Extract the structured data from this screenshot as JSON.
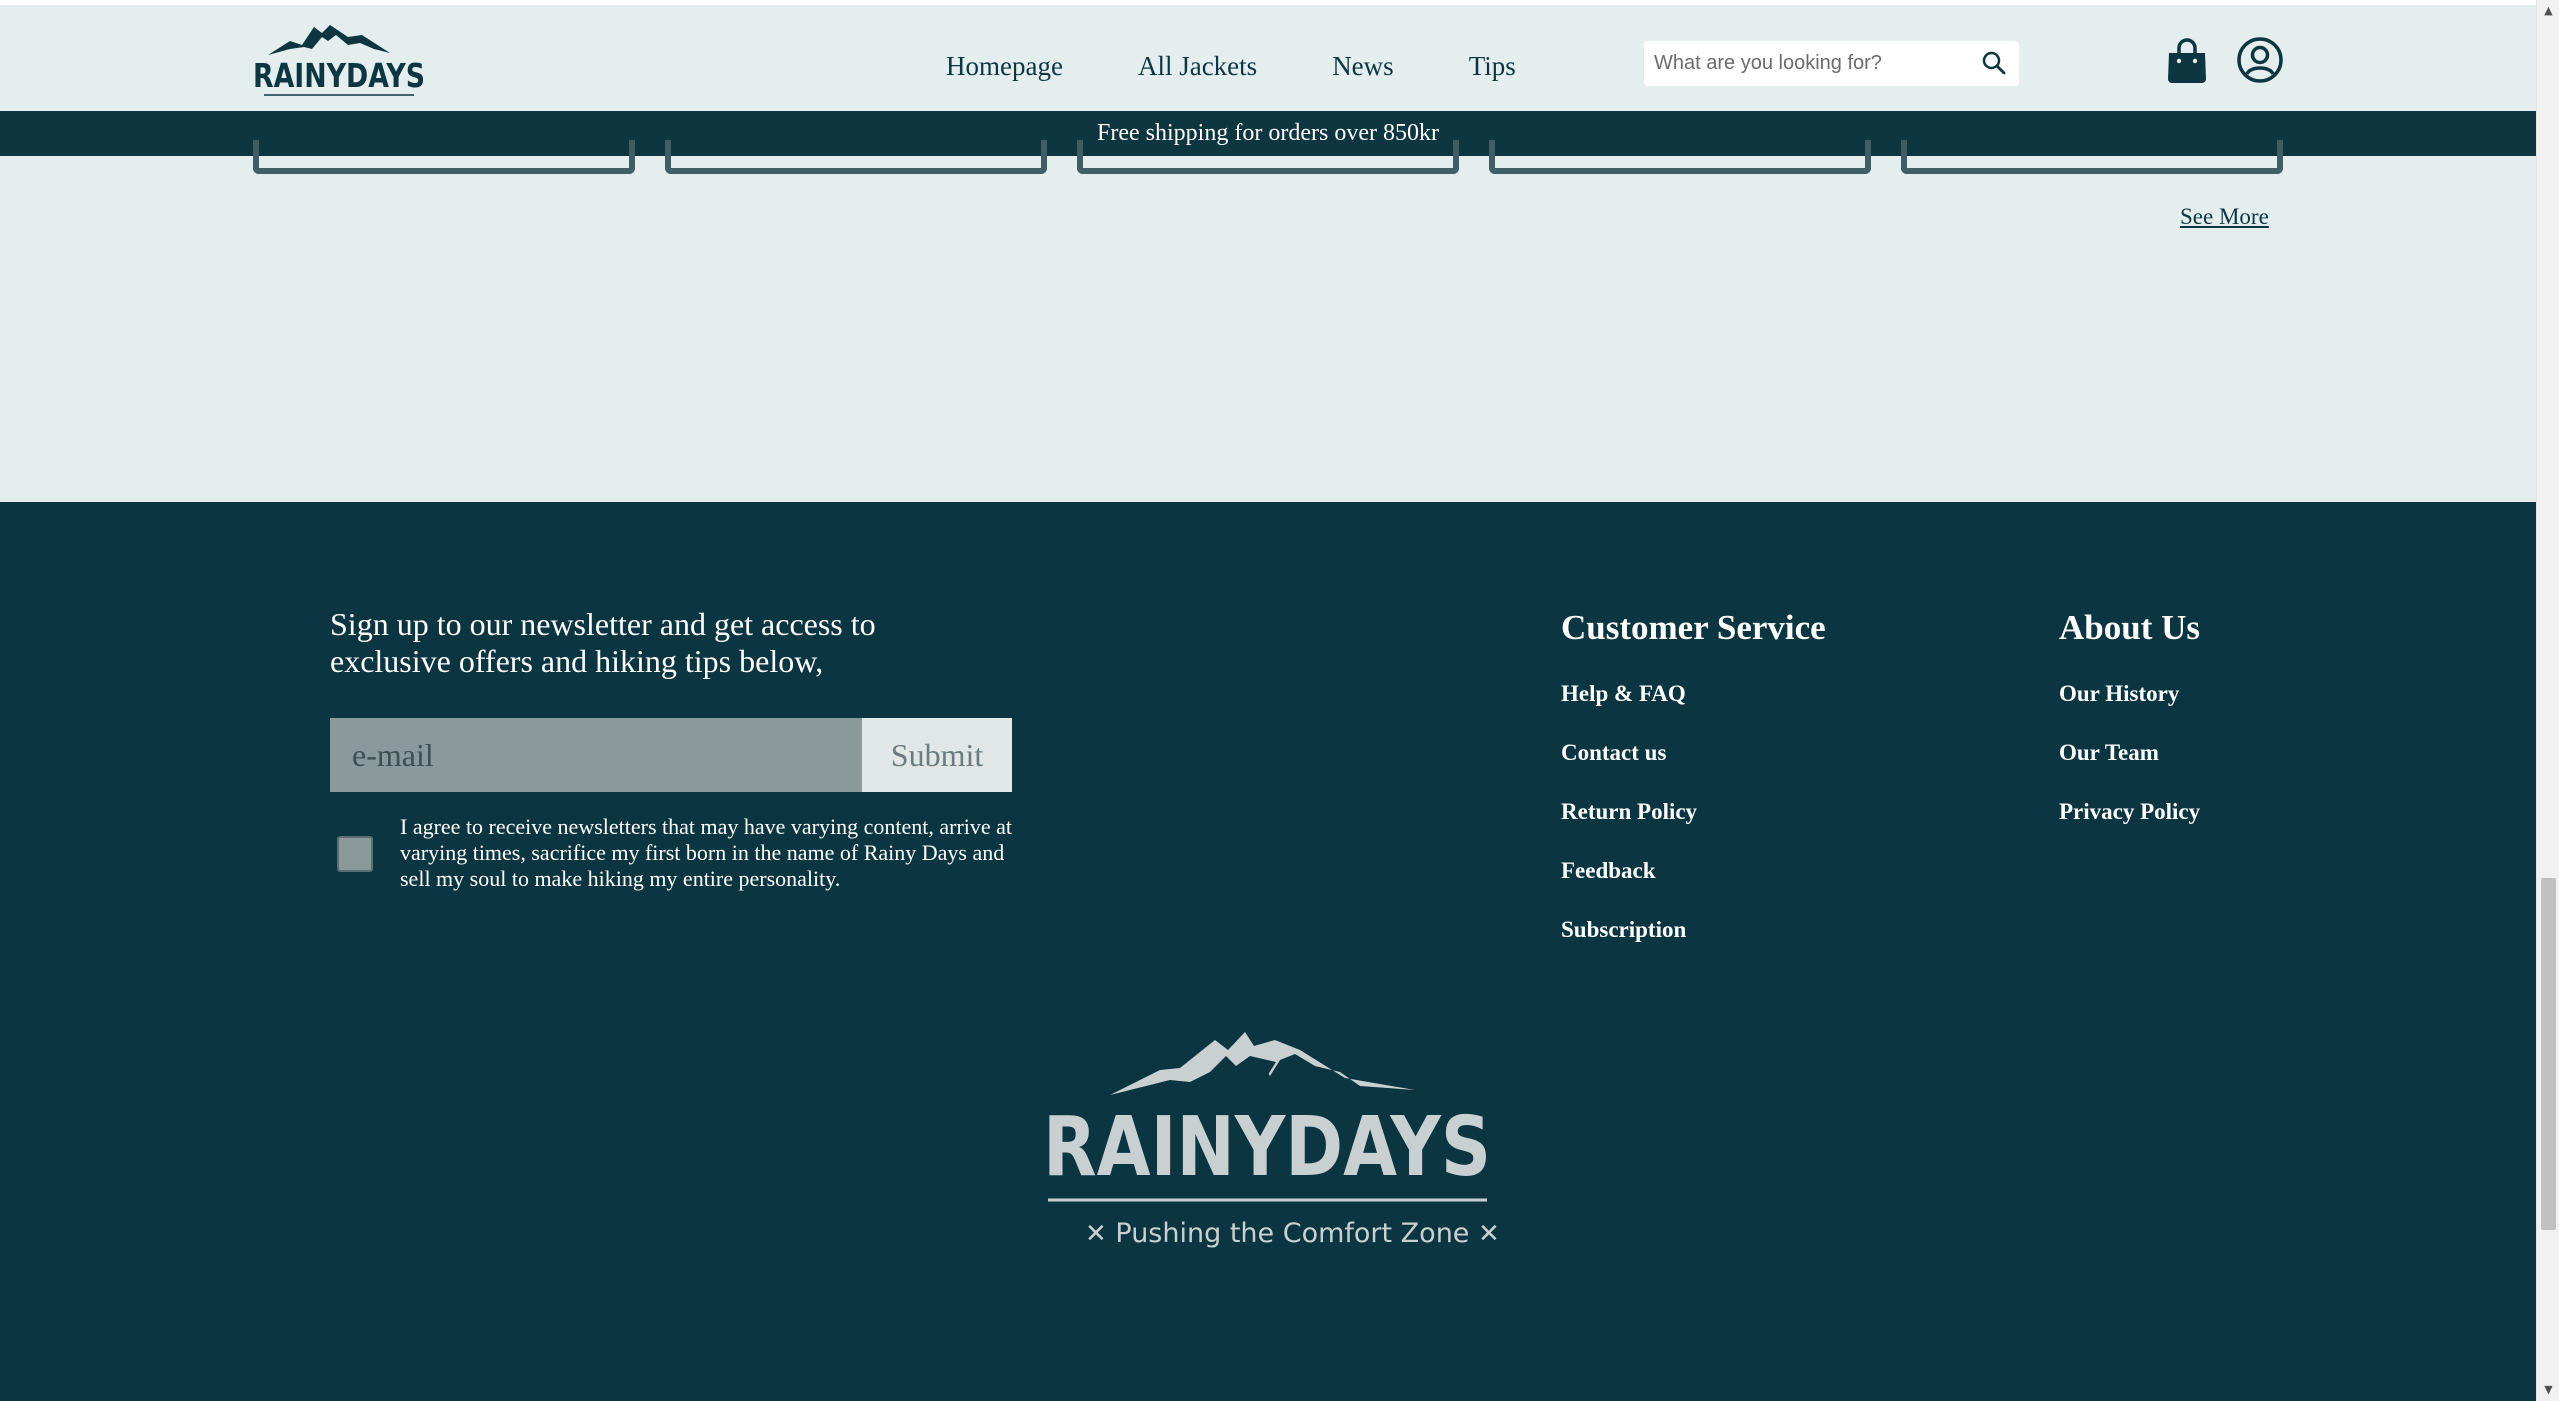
{
  "header": {
    "logo_text": "RAINYDAYS",
    "nav": [
      "Homepage",
      "All Jackets",
      "News",
      "Tips"
    ],
    "search_placeholder": "What are you looking for?"
  },
  "shipping_banner": "Free shipping for orders over 850kr",
  "products": {
    "see_more": "See More"
  },
  "footer": {
    "newsletter_text": "Sign up to our newsletter and get access to exclusive offers and hiking tips below,",
    "email_placeholder": "e-mail",
    "submit_label": "Submit",
    "agree_text": "I agree to receive newsletters that may have varying content, arrive at varying times, sacrifice my first born in the name of Rainy Days and sell my soul to make hiking my entire personality.",
    "customer_service": {
      "title": "Customer Service",
      "links": [
        "Help & FAQ",
        "Contact us",
        "Return Policy",
        "Feedback",
        "Subscription"
      ]
    },
    "about_us": {
      "title": "About Us",
      "links": [
        "Our History",
        "Our Team",
        "Privacy Policy"
      ]
    },
    "logo_text": "RAINYDAYS",
    "tagline": "Pushing the Comfort Zone"
  },
  "colors": {
    "brand_dark": "#0b3540",
    "background": "#e4eeee",
    "logo_light": "#c8d0d2"
  }
}
